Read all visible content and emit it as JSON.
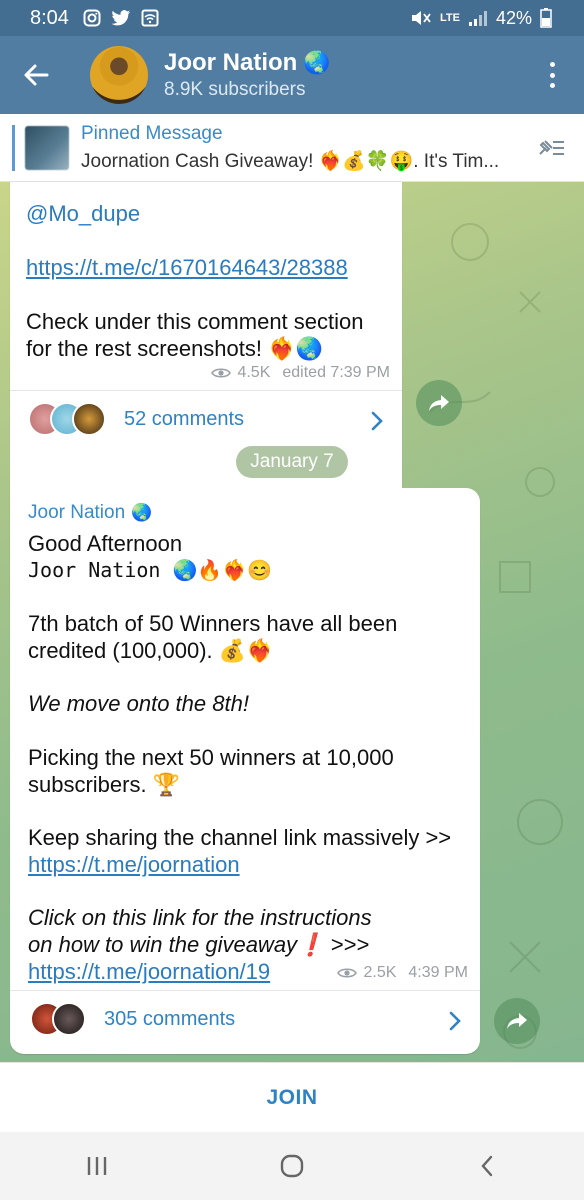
{
  "status_bar": {
    "time": "8:04",
    "battery": "42%",
    "network": "LTE"
  },
  "channel": {
    "name": "Joor Nation",
    "subscribers": "8.9K subscribers",
    "globe_emoji": "🌏"
  },
  "pinned": {
    "title": "Pinned Message",
    "text": "Joornation Cash Giveaway! ❤️‍🔥💰🍀🤑. It's Tim..."
  },
  "message1": {
    "mention": "@Mo_dupe",
    "link": "https://t.me/c/1670164643/28388",
    "text_line1": "Check under this comment section",
    "text_line2": "for the rest screenshots! ❤️‍🔥🌏",
    "views": "4.5K",
    "time": "edited 7:39 PM",
    "comments": "52 comments"
  },
  "date_chip": "January 7",
  "message2": {
    "sender": "Joor Nation",
    "sender_emoji": "🌏",
    "greeting": "Good Afternoon",
    "greeting_sub": "Joor Nation 🌏🔥❤️‍🔥😊",
    "batch_line1": "7th batch of 50 Winners have all been",
    "batch_line2": "credited (100,000). 💰❤️‍🔥",
    "italic_line": "We move onto the 8th!",
    "picking_line1": "Picking the next 50 winners at 10,000",
    "picking_line2": "subscribers. 🏆",
    "sharing_line": "Keep sharing the channel link massively >>",
    "channel_link": "https://t.me/joornation",
    "instructions_line1": "Click on this link for the instructions",
    "instructions_line2": "on how to win the giveaway❗ >>>",
    "instructions_link": "https://t.me/joornation/19",
    "views": "2.5K",
    "time": "4:39 PM",
    "comments": "305 comments"
  },
  "join_button": "JOIN",
  "colors": {
    "header": "#527da3",
    "status": "#446e91",
    "accent": "#2f83c4"
  }
}
